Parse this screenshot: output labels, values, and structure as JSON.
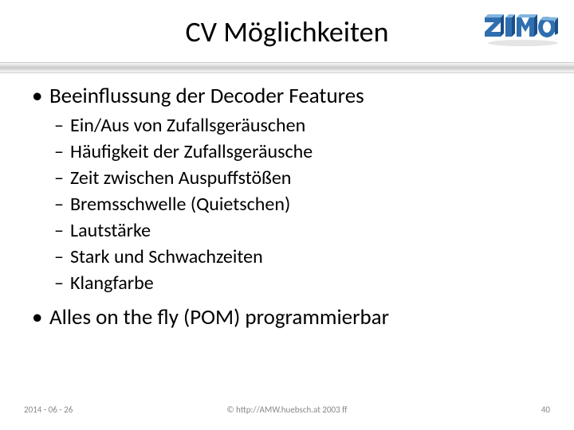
{
  "header": {
    "title": "CV Möglichkeiten",
    "logo_text": "ZIMO"
  },
  "content": {
    "bullets": [
      {
        "level": 1,
        "text": "Beeinflussung der Decoder Features"
      },
      {
        "level": 2,
        "text": "Ein/Aus von Zufallsgeräuschen"
      },
      {
        "level": 2,
        "text": "Häufigkeit der Zufallsgeräusche"
      },
      {
        "level": 2,
        "text": "Zeit zwischen Auspuffstößen"
      },
      {
        "level": 2,
        "text": "Bremsschwelle (Quietschen)"
      },
      {
        "level": 2,
        "text": "Lautstärke"
      },
      {
        "level": 2,
        "text": "Stark und Schwachzeiten"
      },
      {
        "level": 2,
        "text": "Klangfarbe"
      },
      {
        "level": 1,
        "text": "Alles on the fly (POM) programmierbar"
      }
    ]
  },
  "footer": {
    "date": "2014 - 06 - 26",
    "copyright": "© http://AMW.huebsch.at 2003 ff",
    "page": "40"
  },
  "colors": {
    "logo_face": "#2f6fb0",
    "logo_side": "#1b4f86",
    "logo_top": "#7fb4e0"
  }
}
